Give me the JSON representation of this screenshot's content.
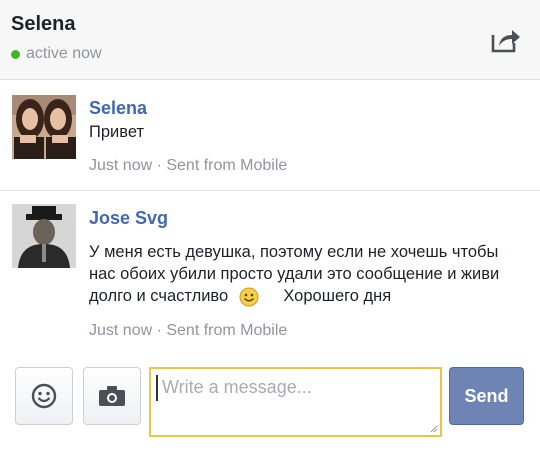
{
  "header": {
    "name": "Selena",
    "status": "active now",
    "status_color": "#42b72a",
    "share_icon": "share-icon"
  },
  "messages": [
    {
      "sender": "Selena",
      "text": "Привет",
      "meta": "Just now · Sent from Mobile",
      "avatar_icon": "avatar-photo-two-women"
    },
    {
      "sender": "Jose Svg",
      "text_part1": "У меня есть девушка, поэтому если не хочешь чтобы нас обоих убили  просто удали это сообщение и живи долго и счастливо",
      "emoji_icon": "smiley-emoji",
      "text_part2": "Хорошего дня",
      "meta": "Just now · Sent from Mobile",
      "avatar_icon": "avatar-photo-man-in-hat"
    }
  ],
  "composer": {
    "emoji_icon": "smiley-icon",
    "camera_icon": "camera-icon",
    "placeholder": "Write a message...",
    "send_label": "Send"
  },
  "colors": {
    "accent": "#4267b2",
    "send_button": "#6d84b4",
    "input_border": "#e9c646",
    "meta_text": "#90949c"
  }
}
